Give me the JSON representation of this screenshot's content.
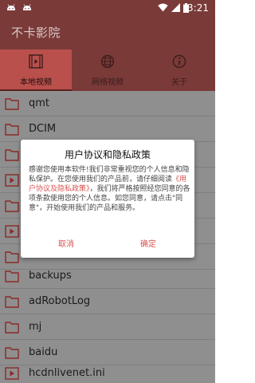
{
  "status": {
    "time": "3:21"
  },
  "app": {
    "title": "不卡影院"
  },
  "tabs": [
    {
      "label": "本地视频",
      "icon": "video-icon"
    },
    {
      "label": "网络视频",
      "icon": "globe-icon"
    },
    {
      "label": "关于",
      "icon": "info-icon"
    }
  ],
  "files": [
    {
      "name": "qmt",
      "type": "folder"
    },
    {
      "name": "DCIM",
      "type": "folder"
    },
    {
      "name": "",
      "type": "folder"
    },
    {
      "name": "",
      "type": "video"
    },
    {
      "name": "",
      "type": "folder"
    },
    {
      "name": "",
      "type": "video"
    },
    {
      "name": "",
      "type": "folder"
    },
    {
      "name": "backups",
      "type": "folder"
    },
    {
      "name": "adRobotLog",
      "type": "folder"
    },
    {
      "name": "mj",
      "type": "folder"
    },
    {
      "name": "baidu",
      "type": "folder"
    },
    {
      "name": "hcdnlivenet.ini",
      "type": "video"
    }
  ],
  "dialog": {
    "title": "用户协议和隐私政策",
    "body_part1": "感谢您使用本软件!我们非常重视您的个人信息和隐私保护。在您使用我们的产品前，请仔细阅读",
    "body_link": "《用户协议及隐私政策》",
    "body_part2": "，我们将严格按照经您同意的各项条款使用您的个人信息。如您同意，请点击\"同意\"，开始使用我们的产品和服务。",
    "cancel_label": "取消",
    "confirm_label": "确定"
  },
  "colors": {
    "app_bar": "#7a3a38",
    "tab_active": "#b9504c",
    "accent": "#d9534f",
    "folder": "#8b2a28"
  }
}
